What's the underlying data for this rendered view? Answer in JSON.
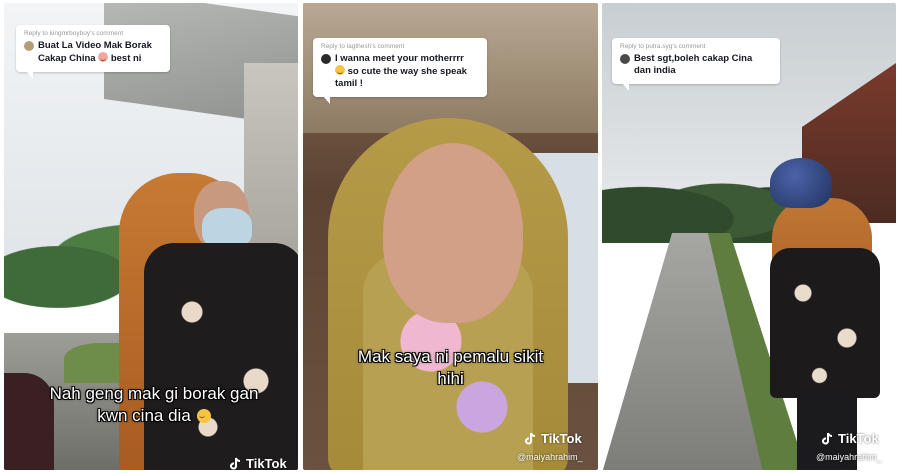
{
  "panels": [
    {
      "reply_to": "Reply to kingmrboyboy's comment",
      "comment": "Buat La Video Mak Borak Cakap China",
      "comment_tail": "best ni",
      "caption_line1": "Nah geng mak gi borak gan",
      "caption_line2": "kwn cina dia",
      "logo_text": "TikTok",
      "handle": ""
    },
    {
      "reply_to": "Reply to lagthesh's comment",
      "comment": "I wanna meet your motherrrr",
      "comment_tail": "so cute the way she speak tamil !",
      "caption_line1": "Mak saya ni pemalu sikit",
      "caption_line2": "hihi",
      "logo_text": "TikTok",
      "handle": "@maiyahrahim_"
    },
    {
      "reply_to": "Reply to putra.syg's comment",
      "comment": "Best sgt,boleh cakap Cina",
      "comment_tail": "dan india",
      "caption_line1": "",
      "caption_line2": "",
      "logo_text": "TikTok",
      "handle": "@maiyahrahim_"
    }
  ],
  "icons": {
    "tiktok_logo": "tiktok-note-icon",
    "emoji": "smiling-emoji-icon"
  },
  "colors": {
    "caption_text": "#ffffff",
    "reply_bubble": "#ffffff",
    "reply_to_text": "#9a9a9a"
  }
}
